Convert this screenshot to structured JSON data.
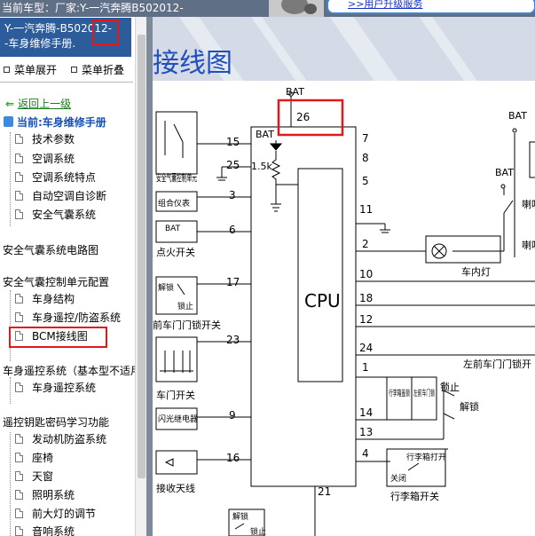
{
  "topbar": {
    "model_text": "当前车型：厂家:Y-一汽奔腾B502012-",
    "upgrade_link": ">>用户升级服务"
  },
  "sidebar": {
    "title_line1": "Y-一汽奔腾-B502012-",
    "title_line2": "-车身维修手册.",
    "expand_label": "菜单展开",
    "collapse_label": "菜单折叠",
    "back_label": "返回上一级",
    "current_label": "当前:车身维修手册",
    "items": [
      {
        "label": "技术参数",
        "level": 2
      },
      {
        "label": "空调系统",
        "level": 2
      },
      {
        "label": "空调系统特点",
        "level": 2
      },
      {
        "label": "自动空调自诊断",
        "level": 2
      },
      {
        "label": "安全气囊系统",
        "level": 2
      },
      {
        "label": "安全气囊系统电路图",
        "level": 1
      },
      {
        "label": "安全气囊控制单元配置",
        "level": 1
      },
      {
        "label": "车身结构",
        "level": 2
      },
      {
        "label": "车身遥控/防盗系统",
        "level": 2
      },
      {
        "label": "BCM接线图",
        "level": 2
      },
      {
        "label": "车身遥控系统（基本型不适用）",
        "level": 1
      },
      {
        "label": "车身遥控系统",
        "level": 2
      },
      {
        "label": "遥控钥匙密码学习功能",
        "level": 1
      },
      {
        "label": "发动机防盗系统",
        "level": 2
      },
      {
        "label": "座椅",
        "level": 2
      },
      {
        "label": "天窗",
        "level": 2
      },
      {
        "label": "照明系统",
        "level": 2
      },
      {
        "label": "前大灯的调节",
        "level": 2
      },
      {
        "label": "音响系统",
        "level": 2
      }
    ]
  },
  "main": {
    "page_title": "接线图"
  },
  "diagram": {
    "cpu_label": "CPU",
    "bat": "BAT",
    "resistor": "1.5k",
    "left_pins": [
      "15",
      "25",
      "3",
      "6",
      "17",
      "23",
      "9",
      "16"
    ],
    "right_pins": [
      "7",
      "8",
      "5",
      "11",
      "2",
      "10",
      "18",
      "12",
      "24",
      "1",
      "14",
      "13",
      "4"
    ],
    "top_pin": "26",
    "bottom_pin": "21",
    "components": {
      "airbag_unit": "安全气囊控制单元",
      "instrument_cluster": "组合仪表",
      "ignition_switch": "点火开关",
      "front_door_lock_switch": "前车门门锁开关",
      "unlock": "解锁",
      "lock": "锁止",
      "door_switch": "车门开关",
      "flasher_relay": "闪光继电器",
      "antenna": "接收天线",
      "dome_light": "车内灯",
      "left_front_door_lock_switch": "左前车门门锁开",
      "trunk_lock": "行李箱盖锁",
      "left_front_door_lock": "左前车门锁",
      "trunk_open": "行李箱打开",
      "close": "关闭",
      "trunk_switch": "行李箱开关",
      "horn_relay": "喇叭继电器",
      "horn": "喇叭"
    }
  },
  "colors": {
    "sidebar_title_bg": "#2d5c9a",
    "highlight": "#e01a1a",
    "page_title": "#1f4fbf",
    "link": "#1630c8"
  }
}
